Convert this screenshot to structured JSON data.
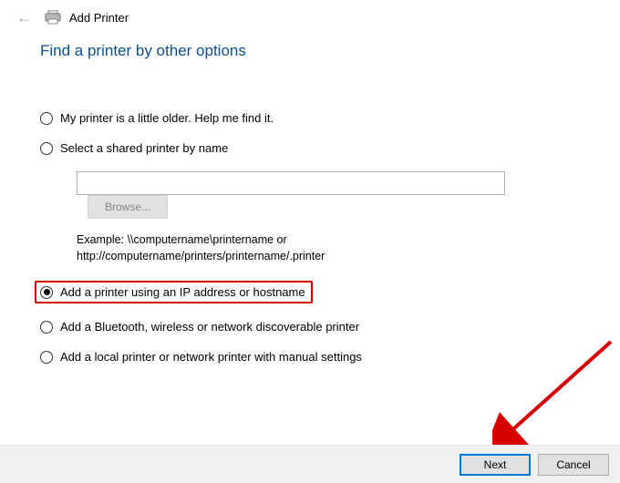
{
  "window": {
    "title": "Add Printer"
  },
  "heading": "Find a printer by other options",
  "options": {
    "older": "My printer is a little older. Help me find it.",
    "shared": "Select a shared printer by name",
    "ip": "Add a printer using an IP address or hostname",
    "bluetooth": "Add a Bluetooth, wireless or network discoverable printer",
    "local": "Add a local printer or network printer with manual settings"
  },
  "shared": {
    "input_value": "",
    "browse_label": "Browse...",
    "example_line1": "Example: \\\\computername\\printername or",
    "example_line2": "http://computername/printers/printername/.printer"
  },
  "footer": {
    "next": "Next",
    "cancel": "Cancel"
  }
}
